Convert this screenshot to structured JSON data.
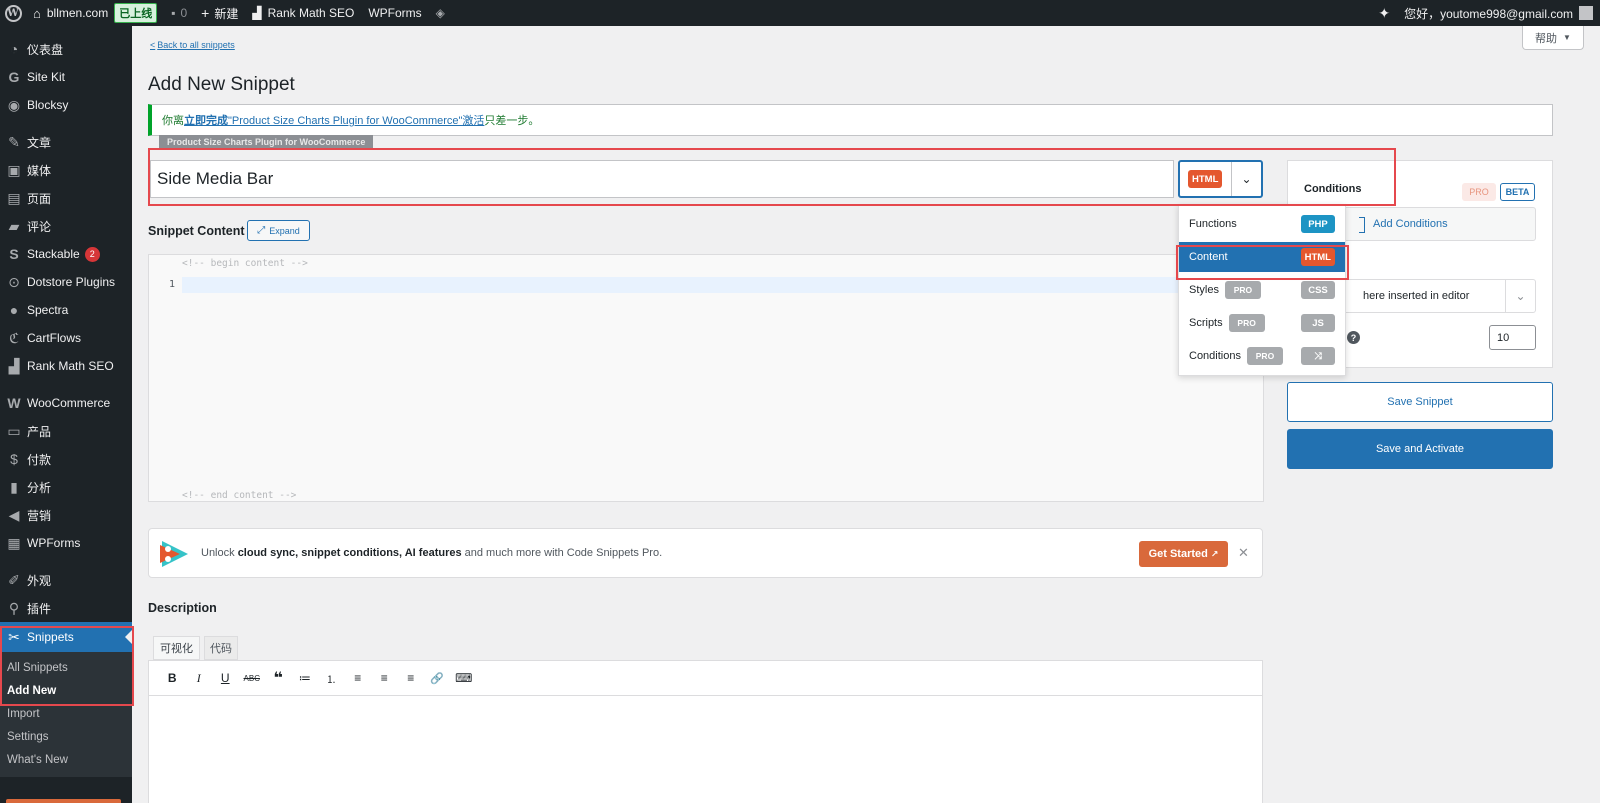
{
  "admin_bar": {
    "site_name": "bllmen.com",
    "live_badge": "已上线",
    "comments_count": "0",
    "new_label": "新建",
    "rank_math": "Rank Math SEO",
    "wpforms": "WPForms",
    "greeting": "您好，youtome998@gmail.com"
  },
  "sidebar": {
    "items": [
      {
        "label": "仪表盘",
        "icon": "dashboard-icon"
      },
      {
        "label": "Site Kit",
        "icon": "google-icon"
      },
      {
        "label": "Blocksy",
        "icon": "blocksy-icon"
      },
      {
        "label": "文章",
        "icon": "pin-icon"
      },
      {
        "label": "媒体",
        "icon": "media-icon"
      },
      {
        "label": "页面",
        "icon": "page-icon"
      },
      {
        "label": "评论",
        "icon": "comment-icon"
      },
      {
        "label": "Stackable",
        "icon": "stackable-icon",
        "count": "2"
      },
      {
        "label": "Dotstore Plugins",
        "icon": "dotstore-icon"
      },
      {
        "label": "Spectra",
        "icon": "spectra-icon"
      },
      {
        "label": "CartFlows",
        "icon": "cartflows-icon"
      },
      {
        "label": "Rank Math SEO",
        "icon": "rankmath-icon"
      },
      {
        "label": "WooCommerce",
        "icon": "woocommerce-icon"
      },
      {
        "label": "产品",
        "icon": "archive-icon"
      },
      {
        "label": "付款",
        "icon": "payment-icon"
      },
      {
        "label": "分析",
        "icon": "chart-icon"
      },
      {
        "label": "营销",
        "icon": "megaphone-icon"
      },
      {
        "label": "WPForms",
        "icon": "forms-icon"
      },
      {
        "label": "外观",
        "icon": "brush-icon"
      },
      {
        "label": "插件",
        "icon": "plugin-icon"
      }
    ],
    "current": {
      "label": "Snippets",
      "icon": "scissors-icon"
    },
    "submenu": [
      "All Snippets",
      "Add New",
      "Import",
      "Settings",
      "What's New"
    ]
  },
  "main": {
    "back_link": "Back to all snippets",
    "help_tab": "帮助",
    "page_title": "Add New Snippet",
    "notice_pre": "你离",
    "notice_link1": "立即完成",
    "notice_link2": "\"Product Size Charts Plugin for WooCommerce\"激活",
    "notice_post": "只差一步。",
    "notice_tag": "Product Size Charts Plugin for WooCommerce",
    "snippet_title": "Side Media Bar",
    "type_badge": "HTML",
    "content_label": "Snippet Content",
    "expand_label": "Expand",
    "editor": {
      "begin_comment": "<!-- begin content -->",
      "end_comment": "<!-- end content -->",
      "line_number": "1"
    },
    "type_dropdown": [
      {
        "label": "Functions",
        "badge": "PHP",
        "pro": ""
      },
      {
        "label": "Content",
        "badge": "HTML",
        "pro": ""
      },
      {
        "label": "Styles",
        "badge": "CSS",
        "pro": "PRO"
      },
      {
        "label": "Scripts",
        "badge": "JS",
        "pro": "PRO"
      },
      {
        "label": "Conditions",
        "badge": "⤨",
        "pro": "PRO"
      }
    ],
    "conditions": {
      "title": "Conditions",
      "pro": "PRO",
      "beta": "BETA",
      "add_label": "Add Conditions",
      "insert_value": "here inserted in editor",
      "priority": "10"
    },
    "save_label": "Save Snippet",
    "activate_label": "Save and Activate",
    "promo": {
      "text_pre": "Unlock ",
      "text_bold": "cloud sync, snippet conditions, AI features",
      "text_post": " and much more with Code Snippets Pro.",
      "cta": "Get Started",
      "cta_arrow": "↗",
      "dismiss": "✕"
    },
    "description_label": "Description",
    "tabs": {
      "visual": "可视化",
      "code": "代码"
    },
    "toolbar": [
      "B",
      "I",
      "U",
      "ABC",
      "❝",
      "≔",
      "⒈",
      "≡",
      "≡",
      "≡",
      "🔗",
      "⌨"
    ]
  },
  "colors": {
    "admin_dark": "#1d2327",
    "primary": "#2271b1",
    "html_badge": "#e4572e",
    "php_badge": "#1d94c4",
    "highlight": "#e5484d",
    "cta": "#d9693b"
  }
}
